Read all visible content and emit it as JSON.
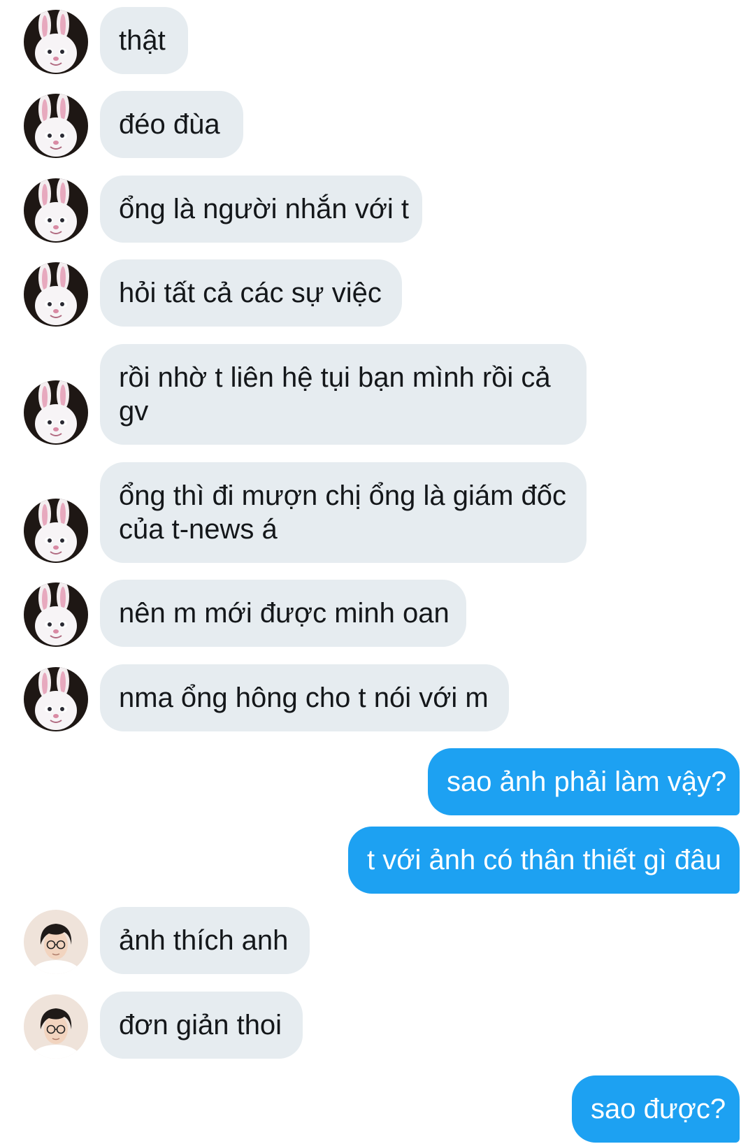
{
  "conversation": {
    "messages": [
      {
        "sender": "incoming",
        "avatar": "bunny-avatar",
        "lines": [
          "thật"
        ]
      },
      {
        "sender": "incoming",
        "avatar": "bunny-avatar",
        "lines": [
          "đéo đùa"
        ]
      },
      {
        "sender": "incoming",
        "avatar": "bunny-avatar",
        "lines": [
          "ổng là người nhắn với t"
        ]
      },
      {
        "sender": "incoming",
        "avatar": "bunny-avatar",
        "lines": [
          "hỏi tất cả các sự việc"
        ]
      },
      {
        "sender": "incoming",
        "avatar": "bunny-avatar",
        "lines": [
          "rồi nhờ t liên hệ tụi bạn mình rồi cả",
          "gv"
        ]
      },
      {
        "sender": "incoming",
        "avatar": "bunny-avatar",
        "lines": [
          "ổng thì đi mượn chị ổng là giám đốc",
          "của t-news á"
        ]
      },
      {
        "sender": "incoming",
        "avatar": "bunny-avatar",
        "lines": [
          "nên m mới được minh oan"
        ]
      },
      {
        "sender": "incoming",
        "avatar": "bunny-avatar",
        "lines": [
          "nma ổng hông cho t nói với m"
        ]
      },
      {
        "sender": "outgoing",
        "lines": [
          "sao ảnh phải làm vậy?"
        ]
      },
      {
        "sender": "outgoing",
        "lines": [
          "t với ảnh có thân thiết gì đâu"
        ]
      },
      {
        "sender": "incoming",
        "avatar": "boy-avatar",
        "lines": [
          "ảnh thích anh"
        ]
      },
      {
        "sender": "incoming",
        "avatar": "boy-avatar",
        "lines": [
          "đơn giản thoi"
        ]
      },
      {
        "sender": "outgoing",
        "lines": [
          "sao được?"
        ]
      }
    ]
  },
  "colors": {
    "incoming_bubble": "#e6ecf0",
    "outgoing_bubble": "#1da1f2",
    "incoming_text": "#14171a",
    "outgoing_text": "#ffffff"
  }
}
